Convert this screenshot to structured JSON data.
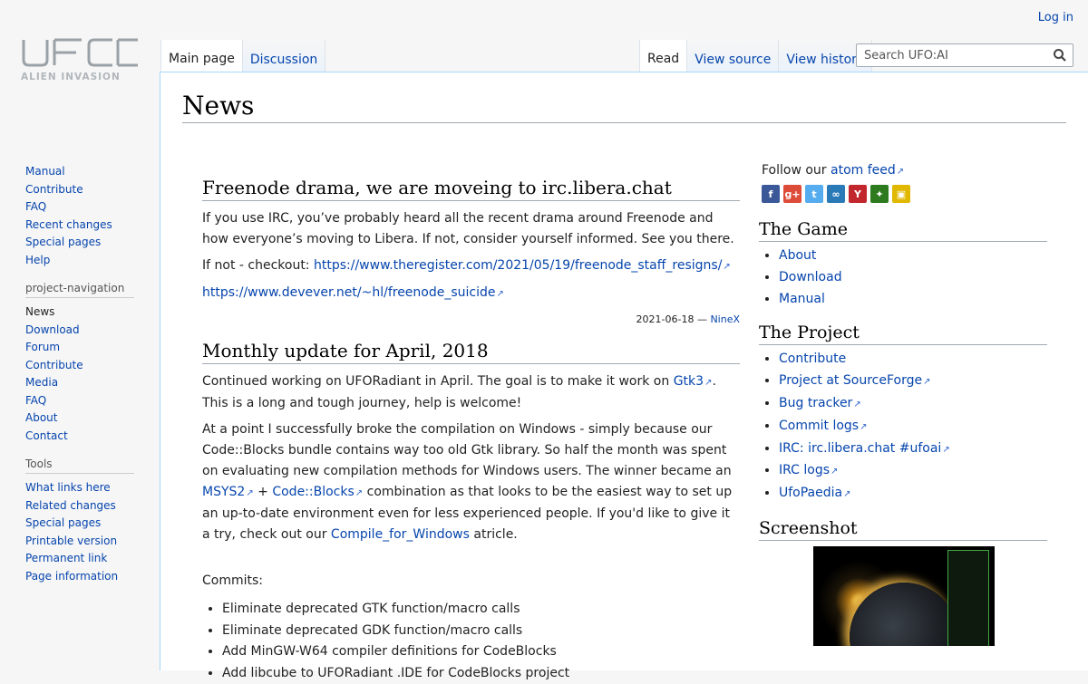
{
  "header": {
    "login": "Log in",
    "logo_top": "UFO",
    "logo_bottom": "ALIEN INVASION"
  },
  "tabs": {
    "left": [
      "Main page",
      "Discussion"
    ],
    "right": [
      "Read",
      "View source",
      "View history"
    ]
  },
  "search": {
    "placeholder": "Search UFO:AI"
  },
  "sidebar": {
    "main": [
      "Manual",
      "Contribute",
      "FAQ",
      "Recent changes",
      "Special pages",
      "Help"
    ],
    "project_heading": "project-navigation",
    "project": [
      "News",
      "Download",
      "Forum",
      "Contribute",
      "Media",
      "FAQ",
      "About",
      "Contact"
    ],
    "tools_heading": "Tools",
    "tools": [
      "What links here",
      "Related changes",
      "Special pages",
      "Printable version",
      "Permanent link",
      "Page information"
    ]
  },
  "page": {
    "title": "News"
  },
  "posts": [
    {
      "title": "Freenode drama, we are moveing to irc.libera.chat",
      "p1": "If you use IRC, you’ve probably heard all the recent drama around Freenode and how everyone’s moving to Libera. If not, consider yourself informed. See you there.",
      "p2_prefix": "If not - checkout: ",
      "link1": "https://www.theregister.com/2021/05/19/freenode_staff_resigns/",
      "link2": "https://www.devever.net/~hl/freenode_suicide",
      "date": "2021-06-18 — ",
      "author": "NineX"
    },
    {
      "title": "Monthly update for April, 2018",
      "p1_a": "Continued working on UFORadiant in April. The goal is to make it work on ",
      "p1_link": "Gtk3",
      "p1_b": ". This is a long and tough journey, help is welcome!",
      "p2_a": "At a point I successfully broke the compilation on Windows - simply because our Code::Blocks bundle contains way too old Gtk library. So half the month was spent on evaluating new compilation methods for Windows users. The winner became an ",
      "p2_link1": "MSYS2",
      "p2_plus": " + ",
      "p2_link2": "Code::Blocks",
      "p2_b": " combination as that looks to be the easiest way to set up an up-to-date environment even for less experienced people. If you'd like to give it a try, check out our ",
      "p2_link3": "Compile_for_Windows",
      "p2_c": " atricle.",
      "commits_label": "Commits:",
      "commits": [
        "Eliminate deprecated GTK function/macro calls",
        "Eliminate deprecated GDK function/macro calls",
        "Add MinGW-W64 compiler definitions for CodeBlocks",
        "Add libcube to UFORadiant .IDE for CodeBlocks project"
      ]
    }
  ],
  "right": {
    "follow_prefix": "Follow our ",
    "follow_link": "atom feed",
    "social_icons": [
      {
        "name": "facebook-icon",
        "glyph": "f",
        "color": "#3b5998"
      },
      {
        "name": "google-plus-icon",
        "glyph": "g+",
        "color": "#dd4b39"
      },
      {
        "name": "twitter-icon",
        "glyph": "t",
        "color": "#55acee"
      },
      {
        "name": "identica-icon",
        "glyph": "∞",
        "color": "#2a7ab8"
      },
      {
        "name": "moddb-icon",
        "glyph": "Y",
        "color": "#c1272d"
      },
      {
        "name": "desura-icon",
        "glyph": "✦",
        "color": "#2d7a1f"
      },
      {
        "name": "indiedb-icon",
        "glyph": "▣",
        "color": "#e0b800"
      }
    ],
    "game_heading": "The Game",
    "game": [
      "About",
      "Download",
      "Manual"
    ],
    "project_heading": "The Project",
    "project": [
      {
        "label": "Contribute",
        "ext": false
      },
      {
        "label": "Project at SourceForge",
        "ext": true
      },
      {
        "label": "Bug tracker",
        "ext": true
      },
      {
        "label": "Commit logs",
        "ext": true
      },
      {
        "label": "IRC: irc.libera.chat #ufoai",
        "ext": true
      },
      {
        "label": "IRC logs",
        "ext": true
      },
      {
        "label": "UfoPaedia",
        "ext": true
      }
    ],
    "screenshot_heading": "Screenshot"
  }
}
